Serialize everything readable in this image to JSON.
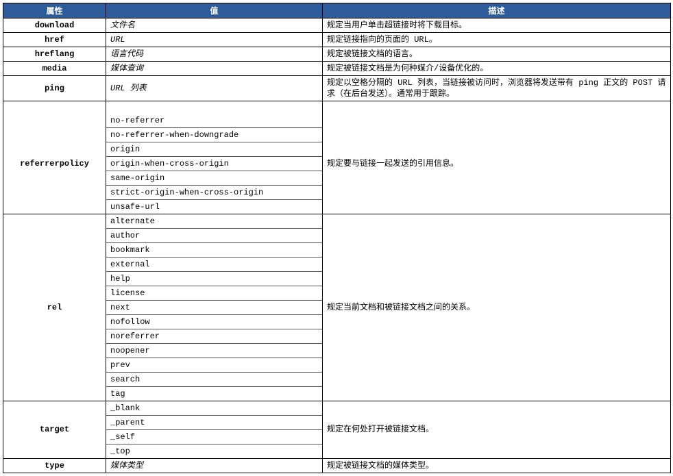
{
  "headers": {
    "attr": "属性",
    "value": "值",
    "desc": "描述"
  },
  "rows": {
    "download": {
      "attr": "download",
      "value": "文件名",
      "desc": "规定当用户单击超链接时将下载目标。"
    },
    "href": {
      "attr": "href",
      "value": "URL",
      "desc": "规定链接指向的页面的 URL。"
    },
    "hreflang": {
      "attr": "hreflang",
      "value": "语言代码",
      "desc": "规定被链接文档的语言。"
    },
    "media": {
      "attr": "media",
      "value": "媒体查询",
      "desc": "规定被链接文档是为何种媒介/设备优化的。"
    },
    "ping": {
      "attr": "ping",
      "value": "URL 列表",
      "desc": "规定以空格分隔的 URL 列表，当链接被访问时，浏览器将发送带有 ping 正文的 POST 请求（在后台发送）。通常用于跟踪。"
    },
    "referrerpolicy": {
      "attr": "referrerpolicy",
      "values": [
        "no-referrer",
        "no-referrer-when-downgrade",
        "origin",
        "origin-when-cross-origin",
        "same-origin",
        "strict-origin-when-cross-origin",
        "unsafe-url"
      ],
      "desc": "规定要与链接一起发送的引用信息。"
    },
    "rel": {
      "attr": "rel",
      "values": [
        "alternate",
        "author",
        "bookmark",
        "external",
        "help",
        "license",
        "next",
        "nofollow",
        "noreferrer",
        "noopener",
        "prev",
        "search",
        "tag"
      ],
      "desc": "规定当前文档和被链接文档之间的关系。"
    },
    "target": {
      "attr": "target",
      "values": [
        "_blank",
        "_parent",
        "_self",
        "_top"
      ],
      "desc": "规定在何处打开被链接文档。"
    },
    "type": {
      "attr": "type",
      "value": "媒体类型",
      "desc": "规定被链接文档的媒体类型。"
    }
  }
}
